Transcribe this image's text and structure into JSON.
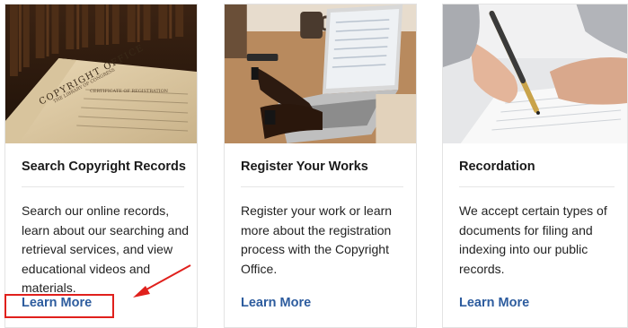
{
  "cards": [
    {
      "title": "Search Copyright Records",
      "description": "Search our online records, learn about our searching and retrieval services, and view educational videos and materials.",
      "link_label": "Learn More",
      "image_text": [
        "COPYRIGHT OFFICE",
        "THE LIBRARY OF CONGRESS",
        "CERTIFICATE OF REGISTRATION"
      ]
    },
    {
      "title": "Register Your Works",
      "description": "Register your work or learn more about the registration process with the Copyright Office.",
      "link_label": "Learn More"
    },
    {
      "title": "Recordation",
      "description": "We accept certain types of documents for filing and indexing into our public records.",
      "link_label": "Learn More"
    }
  ],
  "colors": {
    "link": "#2d5c9e",
    "annotation": "#e0201c"
  }
}
